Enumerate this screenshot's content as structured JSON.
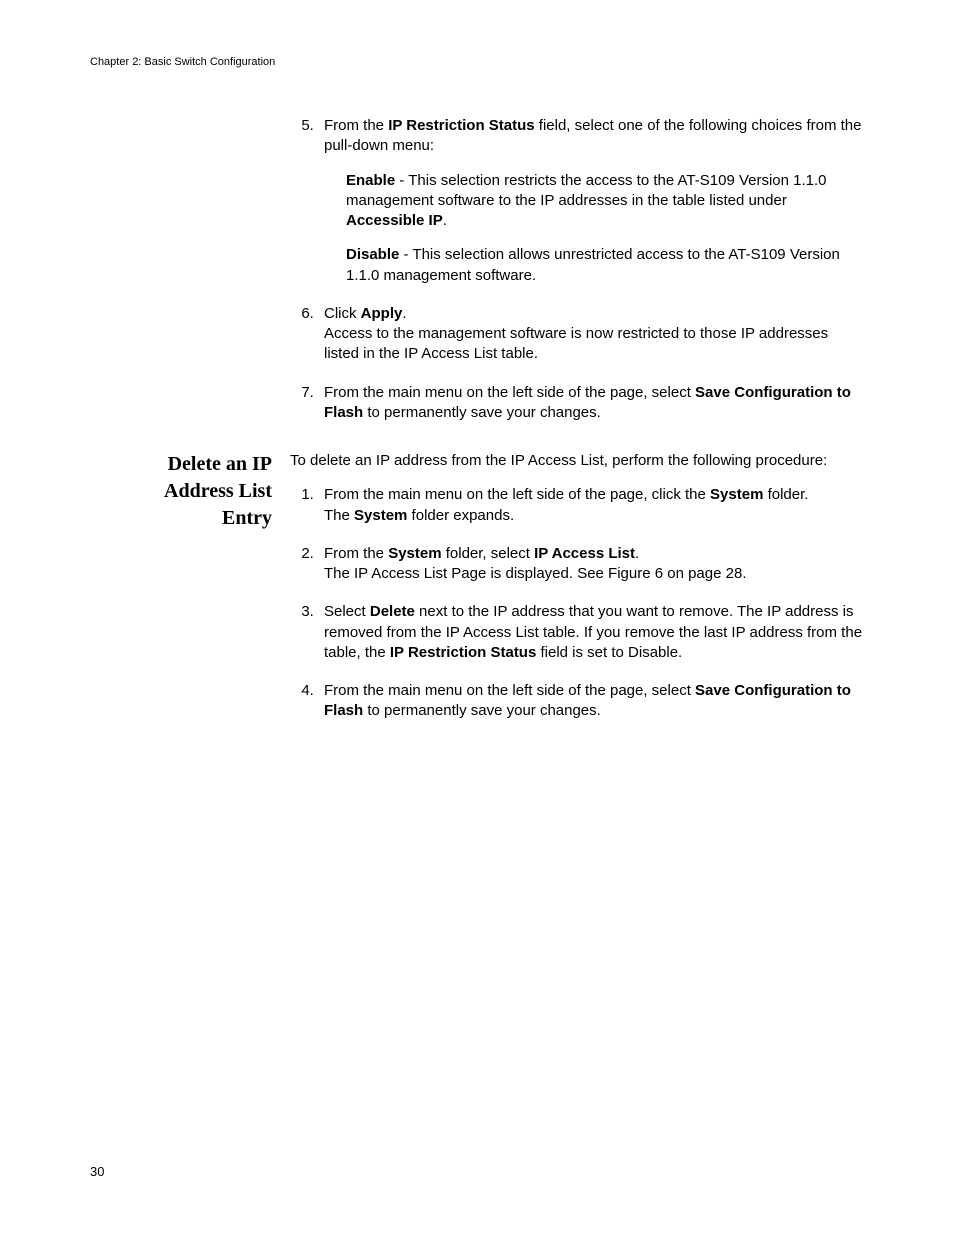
{
  "header": {
    "running": "Chapter 2: Basic Switch Configuration"
  },
  "top_steps": {
    "start": 5,
    "s5": {
      "pre": "From the ",
      "b1": "IP Restriction Status",
      "post": " field, select one of the following choices from the pull-down menu:",
      "enable": {
        "b": "Enable",
        "t": " - This selection restricts the access to the AT-S109 Version 1.1.0  management software to the IP addresses in the table listed under ",
        "b2": "Accessible IP",
        "end": "."
      },
      "disable": {
        "b": "Disable",
        "t": " - This selection allows unrestricted access to the AT-S109 Version 1.1.0  management software."
      }
    },
    "s6": {
      "pre": "Click ",
      "b": "Apply",
      "end": ".",
      "line2": "Access to the management software is now restricted to those IP addresses listed in the IP Access List table."
    },
    "s7": {
      "pre": "From the main menu on the left side of the page, select ",
      "b": "Save Configuration to Flash",
      "post": " to permanently save your changes."
    }
  },
  "section2": {
    "heading_l1": "Delete an IP",
    "heading_l2": "Address List",
    "heading_l3": "Entry",
    "intro": "To delete an IP address from the IP Access List, perform the following procedure:",
    "s1": {
      "pre": "From the main menu on the left side of the page, click the ",
      "b": "System",
      "post": " folder.",
      "line2a": "The ",
      "line2b": "System",
      "line2c": " folder expands."
    },
    "s2": {
      "pre": "From the ",
      "b1": "System",
      "mid": " folder, select ",
      "b2": "IP Access List",
      "end": ".",
      "line2": "The IP Access List Page is displayed. See Figure 6 on page 28."
    },
    "s3": {
      "pre": "Select ",
      "b": "Delete",
      "mid": " next to the IP address that you want to remove. The IP address is removed from the IP Access List table. If you remove the last IP address from the table, the ",
      "b2": "IP Restriction Status",
      "post": " field is set to Disable."
    },
    "s4": {
      "pre": "From the main menu on the left side of the page, select ",
      "b": "Save Configuration to Flash",
      "post": " to permanently save your changes."
    }
  },
  "pagenum": "30"
}
